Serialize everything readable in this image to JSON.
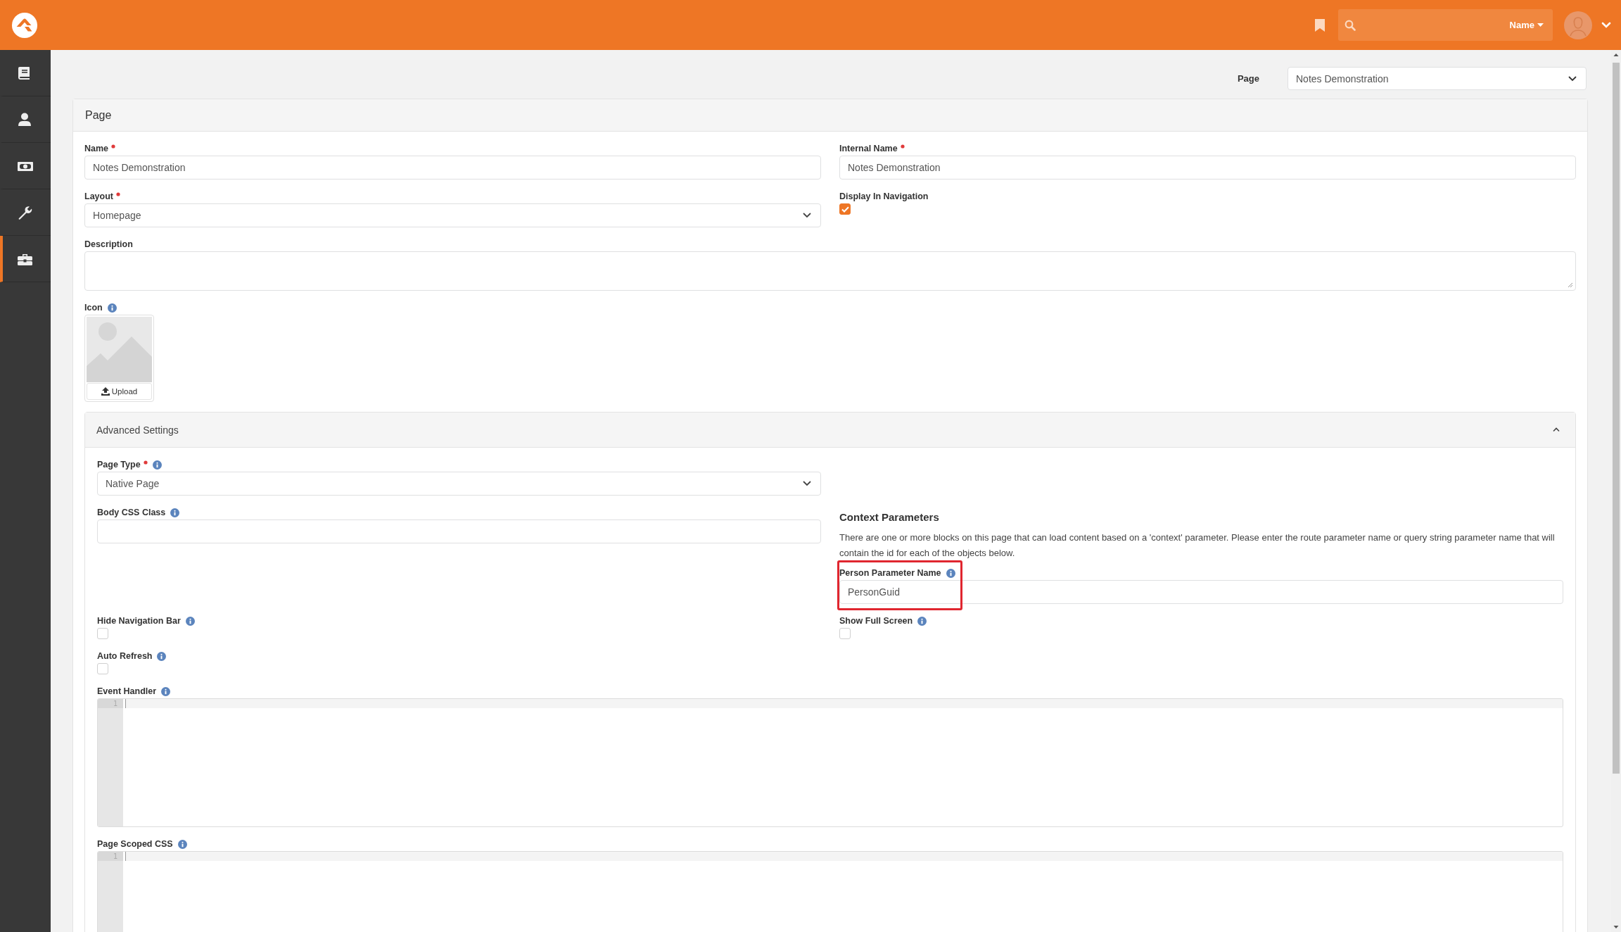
{
  "header": {
    "search": {
      "scope": "Name"
    }
  },
  "sidebar": {
    "items": [
      {
        "selected": false
      },
      {
        "selected": false
      },
      {
        "selected": false
      },
      {
        "selected": false
      },
      {
        "selected": true
      }
    ]
  },
  "page_picker": {
    "label": "Page",
    "value": "Notes Demonstration"
  },
  "panel": {
    "title": "Page",
    "name": {
      "kind": "text",
      "label": "Name",
      "required": true,
      "help": false,
      "value": "Notes Demonstration"
    },
    "internal_name": {
      "kind": "text",
      "label": "Internal Name",
      "required": true,
      "help": false,
      "value": "Notes Demonstration"
    },
    "layout": {
      "kind": "select",
      "label": "Layout",
      "required": true,
      "help": false,
      "value": "Homepage"
    },
    "display_in_navigation": {
      "kind": "checkbox",
      "label": "Display In Navigation",
      "required": false,
      "help": false,
      "checked": true
    },
    "description": {
      "kind": "textarea",
      "label": "Description",
      "required": false,
      "help": false
    },
    "icon": {
      "kind": "image",
      "label": "Icon",
      "required": false,
      "help": true,
      "button": "Upload"
    },
    "advanced": {
      "title": "Advanced Settings",
      "expanded": true,
      "page_type": {
        "kind": "select",
        "label": "Page Type",
        "required": true,
        "help": true,
        "value": "Native Page"
      },
      "body_css_class": {
        "kind": "text",
        "label": "Body CSS Class",
        "required": false,
        "help": true
      },
      "context": {
        "title": "Context Parameters",
        "text": "There are one or more blocks on this page that can load content based on a 'context' parameter. Please enter the route parameter name or query string parameter name that will contain the id for each of the objects below.",
        "fields": [
          {
            "kind": "text",
            "label": "Person Parameter Name",
            "required": false,
            "help": true,
            "value": "PersonGuid",
            "highlighted": true
          }
        ]
      },
      "hide_navigation_bar": {
        "kind": "checkbox",
        "label": "Hide Navigation Bar",
        "required": false,
        "help": true,
        "checked": false
      },
      "show_full_screen": {
        "kind": "checkbox",
        "label": "Show Full Screen",
        "required": false,
        "help": true,
        "checked": false
      },
      "auto_refresh": {
        "kind": "checkbox",
        "label": "Auto Refresh",
        "required": false,
        "help": true,
        "checked": false
      },
      "event_handler": {
        "kind": "code",
        "label": "Event Handler",
        "required": false,
        "help": true,
        "line_numbers": [
          "1"
        ]
      },
      "page_scoped_css": {
        "kind": "code",
        "label": "Page Scoped CSS",
        "required": false,
        "help": true,
        "line_numbers": [
          "1"
        ]
      }
    }
  }
}
